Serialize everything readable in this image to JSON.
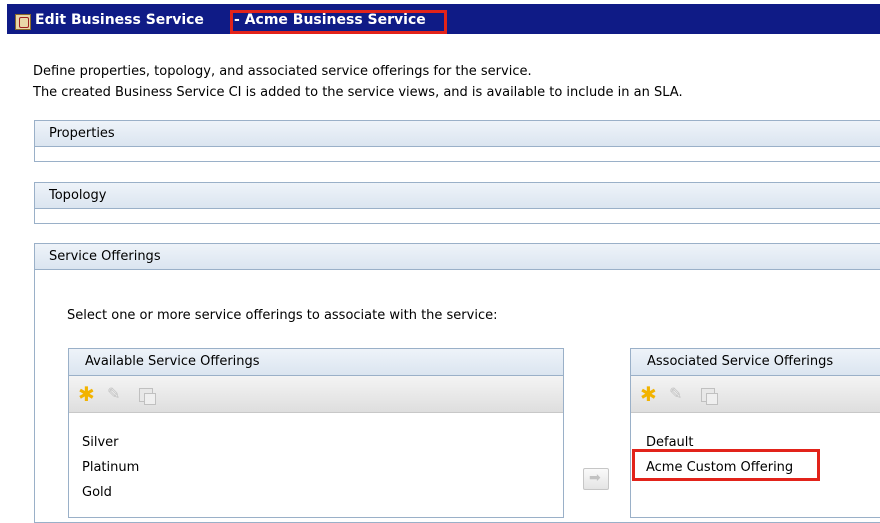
{
  "window": {
    "title": "Edit Business Service",
    "title_suffix": "- Acme Business Service"
  },
  "description": {
    "line1": "Define properties, topology, and associated service offerings for the service.",
    "line2": "The created Business Service CI is added to the service views, and is available to include in an SLA."
  },
  "sections": {
    "properties": "Properties",
    "topology": "Topology",
    "service_offerings": "Service Offerings"
  },
  "service_offerings": {
    "instruction": "Select one or more service offerings to associate with the service:",
    "available": {
      "header": "Available Service Offerings",
      "items": [
        "Silver",
        "Platinum",
        "Gold"
      ]
    },
    "associated": {
      "header": "Associated Service Offerings",
      "items": [
        "Default",
        "Acme Custom Offering"
      ]
    }
  },
  "icons": {
    "toolbar": [
      "new-star-icon",
      "edit-pencil-icon",
      "duplicate-icon"
    ],
    "move": "arrow-right-icon"
  },
  "colors": {
    "title_bar": "#0f1b86",
    "highlight": "#e2231a",
    "star": "#f2b300"
  }
}
